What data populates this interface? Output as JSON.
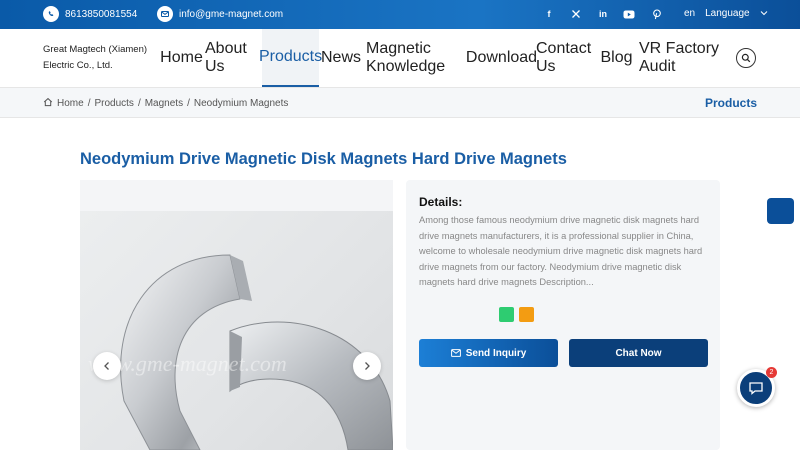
{
  "topbar": {
    "phone": "8613850081554",
    "email": "info@gme-magnet.com",
    "social_icons": [
      "facebook-icon",
      "x-icon",
      "linkedin-icon",
      "youtube-icon",
      "pinterest-icon"
    ],
    "lang_code": "en",
    "lang_label": "Language"
  },
  "header": {
    "company_line1": "Great Magtech (Xiamen)",
    "company_line2": "Electric Co., Ltd.",
    "nav": [
      "Home",
      "About Us",
      "Products",
      "News",
      "Magnetic Knowledge",
      "Download",
      "Contact Us",
      "Blog",
      "VR Factory Audit"
    ],
    "active_nav": "Products"
  },
  "breadcrumb": {
    "items": [
      "Home",
      "Products",
      "Magnets",
      "Neodymium Magnets"
    ],
    "separator": "/",
    "section_title": "Products"
  },
  "product": {
    "title": "Neodymium Drive Magnetic Disk Magnets Hard Drive Magnets",
    "watermark": "www.gme-magnet.com",
    "details_heading": "Details:",
    "description": "Among those famous neodymium drive magnetic disk magnets hard drive magnets manufacturers, it is a professional supplier in China, welcome to wholesale neodymium drive magnetic disk magnets hard drive magnets from our factory. Neodymium drive magnetic disk magnets hard drive magnets Description...",
    "send_inquiry": "Send Inquiry",
    "chat_now": "Chat Now"
  },
  "chat": {
    "badge_count": "2"
  },
  "colors": {
    "brand_blue": "#1a5ea5",
    "navy": "#0b3f7a",
    "share_green": "#2ecc71",
    "share_orange": "#f39c12"
  }
}
